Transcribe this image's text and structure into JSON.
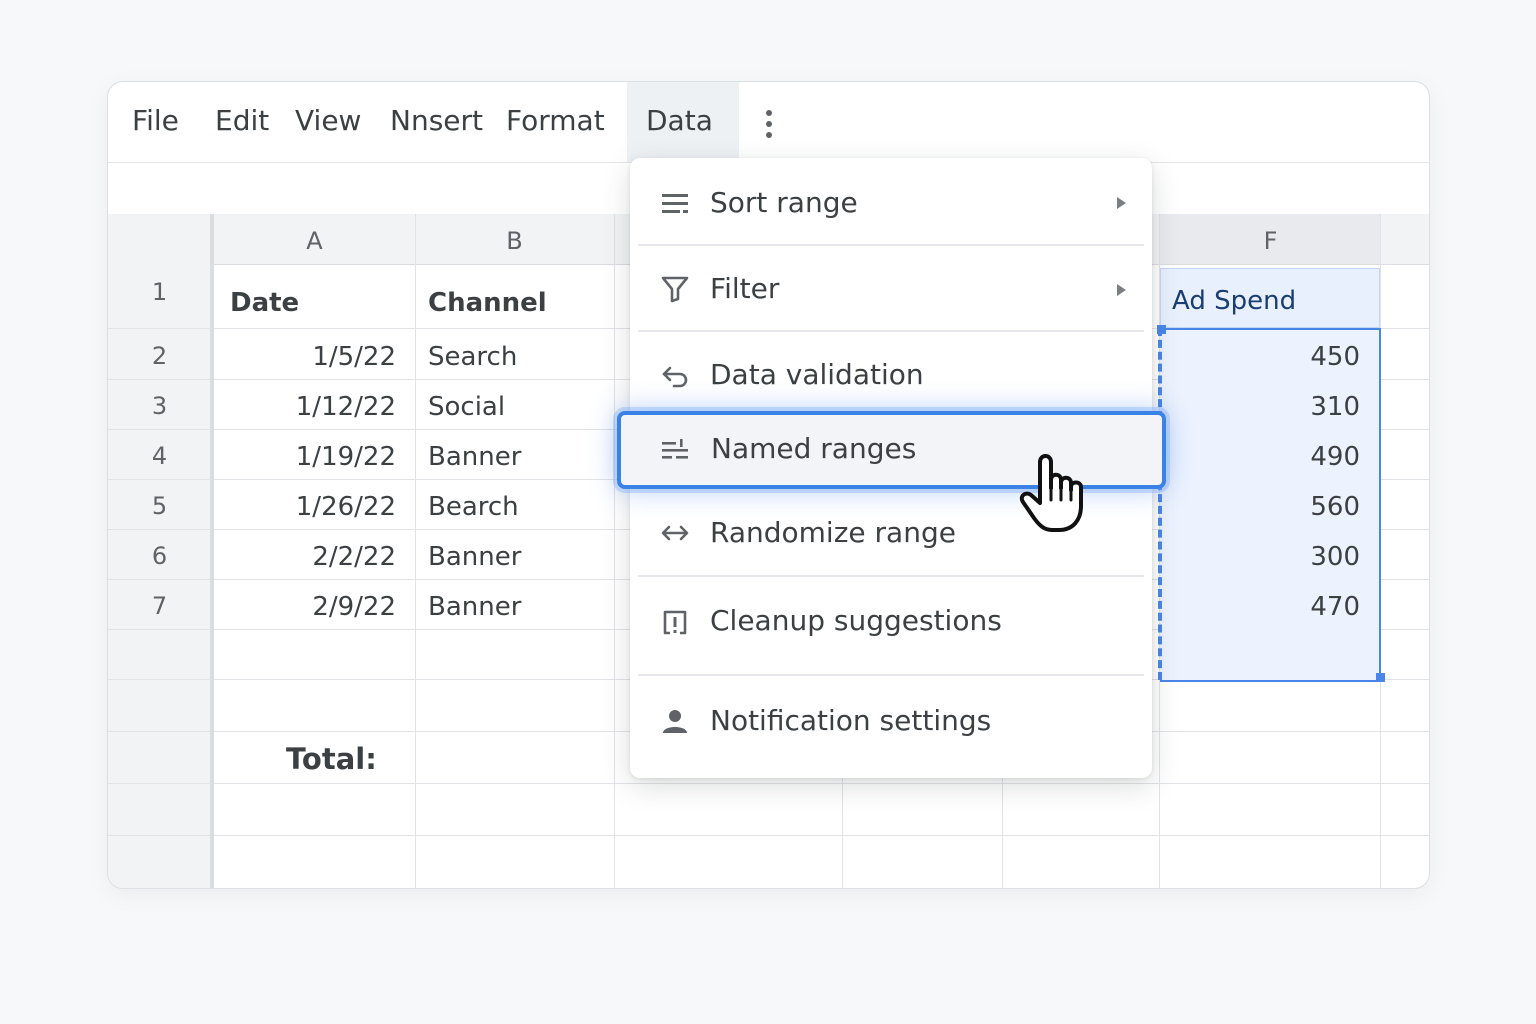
{
  "menubar": {
    "items": [
      "File",
      "Edit",
      "View",
      "Nnsert",
      "Format",
      "Data"
    ],
    "active": "Data",
    "more_icon": "kebab-vertical-icon"
  },
  "grid": {
    "column_headers": [
      "A",
      "B",
      "F"
    ],
    "row_numbers": [
      "1",
      "2",
      "3",
      "4",
      "5",
      "6",
      "7"
    ],
    "header_row": {
      "date": "Date",
      "channel": "Channel",
      "ad_spend": "Ad Spend"
    },
    "rows": [
      {
        "date": "1/5/22",
        "channel": "Search",
        "ad_spend": "450"
      },
      {
        "date": "1/12/22",
        "channel": "Social",
        "ad_spend": "310"
      },
      {
        "date": "1/19/22",
        "channel": "Banner",
        "ad_spend": "490"
      },
      {
        "date": "1/26/22",
        "channel": "Bearch",
        "ad_spend": "560"
      },
      {
        "date": "2/2/22",
        "channel": "Banner",
        "ad_spend": "300"
      },
      {
        "date": "2/9/22",
        "channel": "Banner",
        "ad_spend": "470"
      }
    ],
    "total_label": "Total:"
  },
  "data_menu": {
    "items": [
      {
        "label": "Sort range",
        "icon": "sort-icon",
        "submenu": true
      },
      {
        "label": "Filter",
        "icon": "filter-icon",
        "submenu": true
      },
      {
        "label": "Data validation",
        "icon": "validation-icon",
        "submenu": false
      },
      {
        "label": "Named ranges",
        "icon": "named-ranges-icon",
        "submenu": false,
        "highlighted": true
      },
      {
        "label": "Randomize range",
        "icon": "randomize-icon",
        "submenu": false
      },
      {
        "label": "Cleanup suggestions",
        "icon": "cleanup-icon",
        "submenu": false
      },
      {
        "label": "Notification settings",
        "icon": "person-icon",
        "submenu": false
      }
    ]
  },
  "colors": {
    "accent": "#3b82e6",
    "selection_fill": "#edf3fe",
    "ad_spend_header_text": "#1a3d73"
  }
}
